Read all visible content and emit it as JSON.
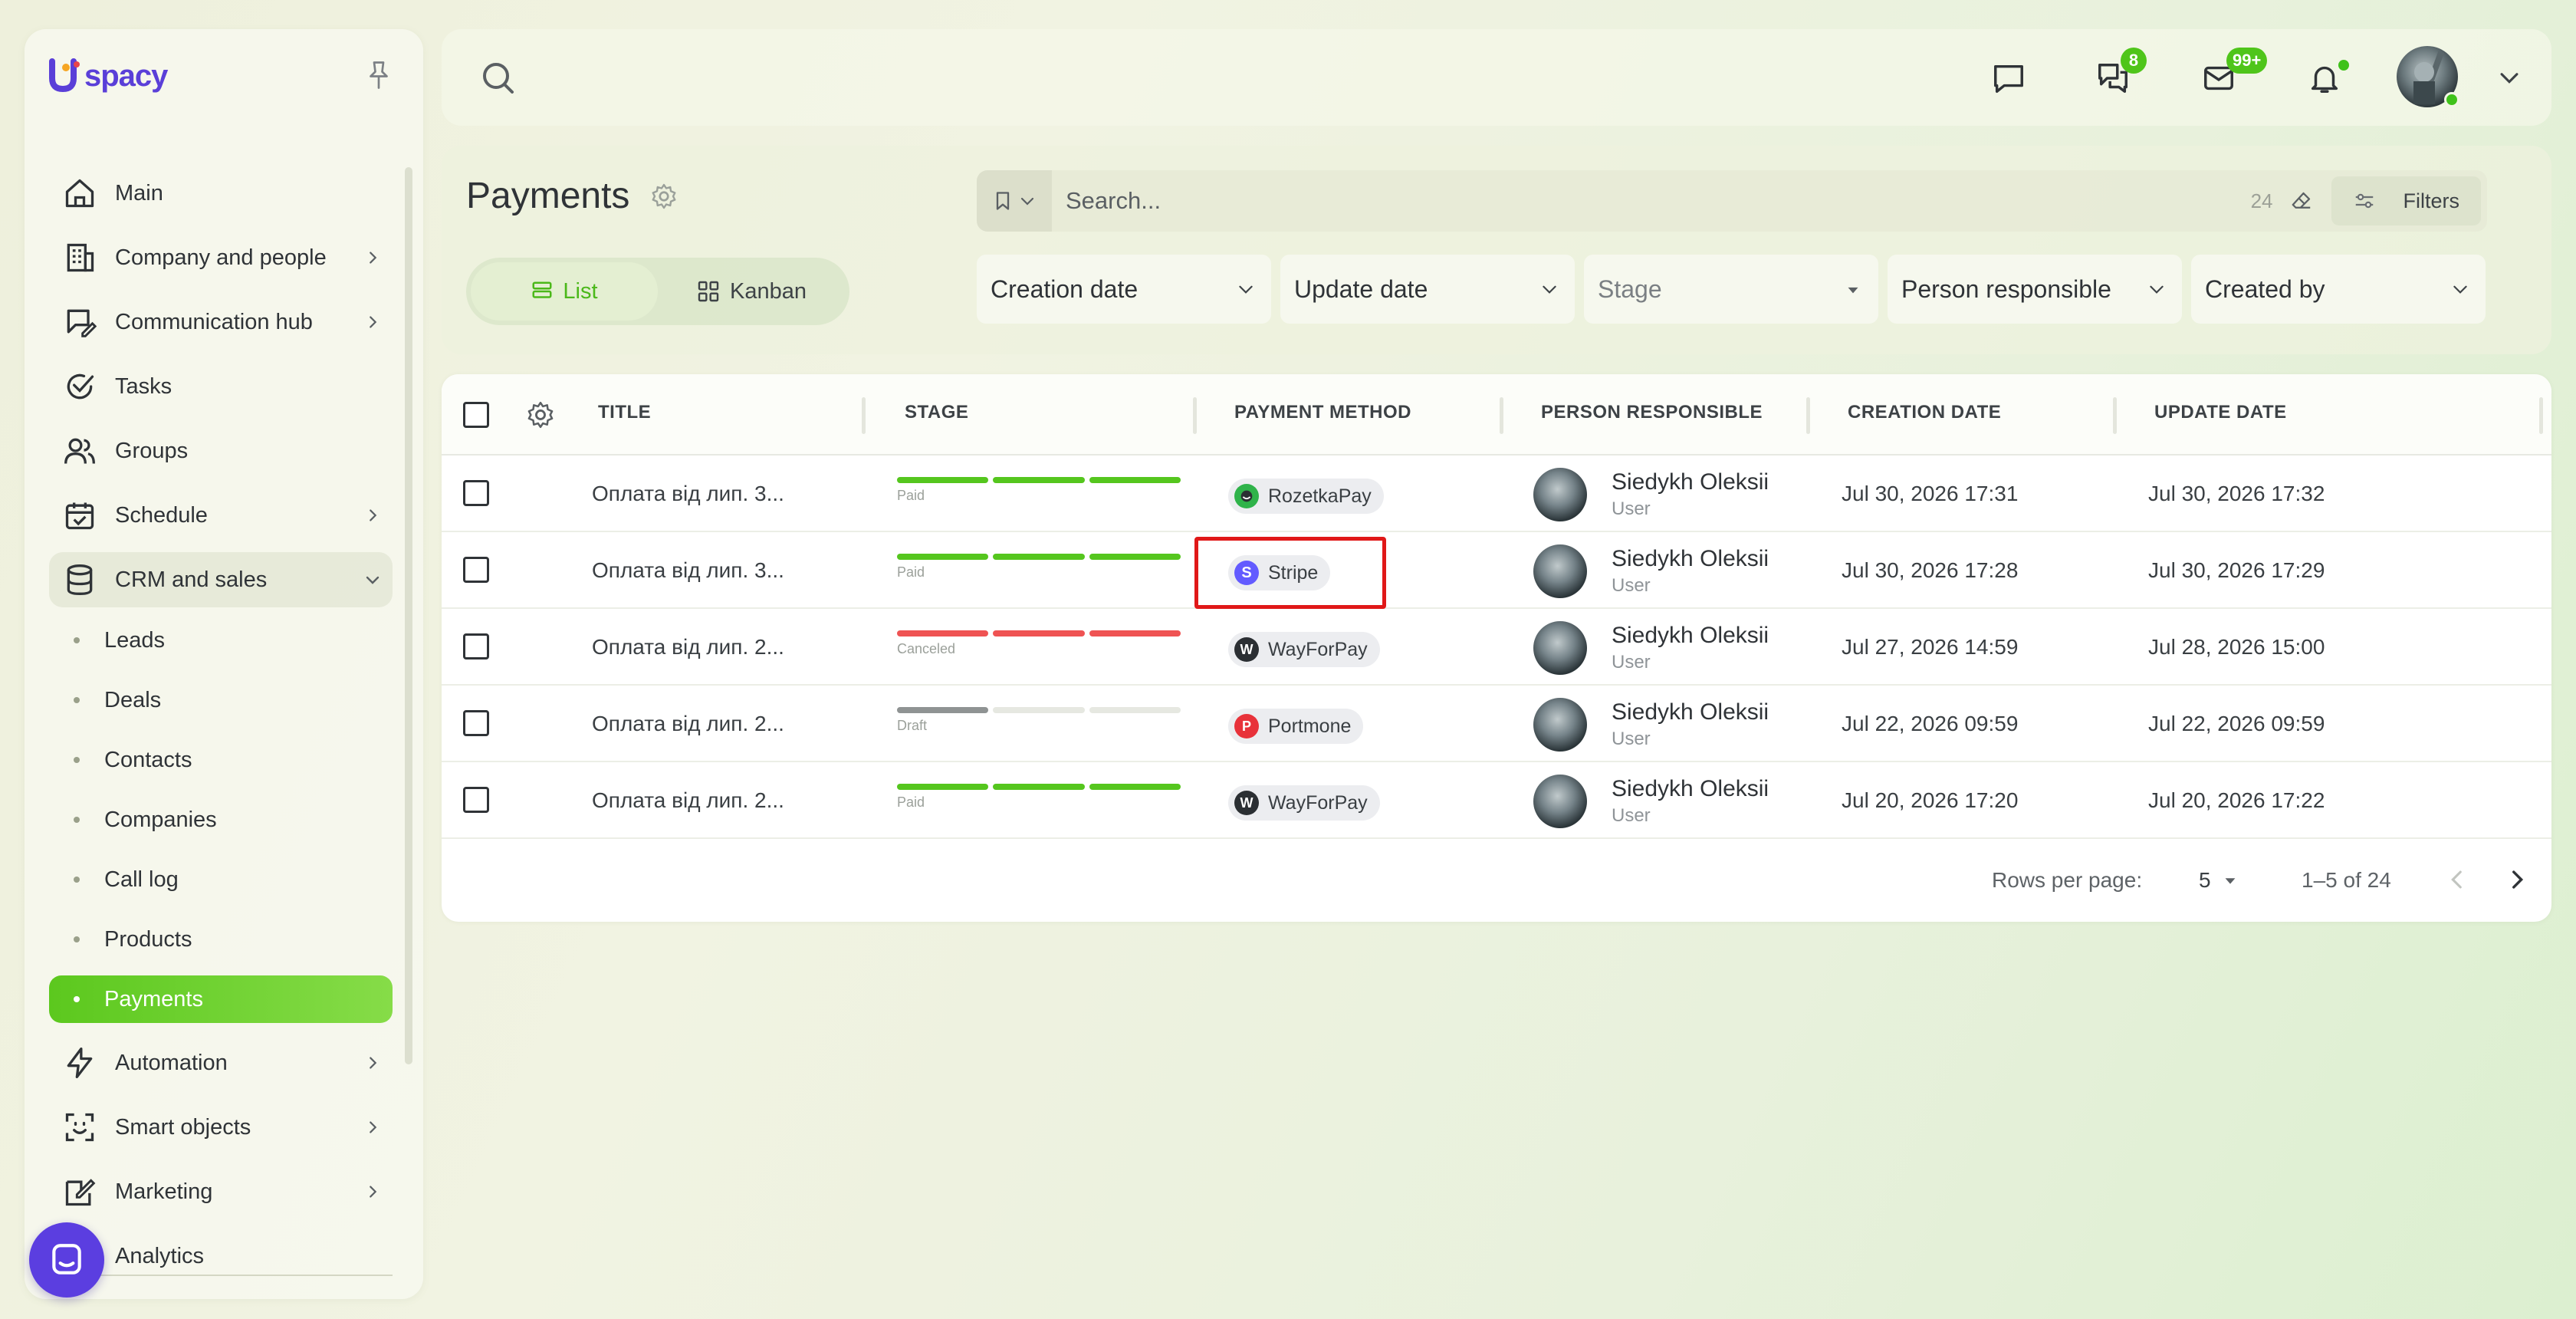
{
  "app": {
    "logo_text": "spacy",
    "brand_color": "#5a3fd8",
    "accent_color": "#5cc81e"
  },
  "sidebar": {
    "items": [
      {
        "label": "Main",
        "icon": "home-icon"
      },
      {
        "label": "Company and people",
        "icon": "building-icon",
        "has_children": true
      },
      {
        "label": "Communication hub",
        "icon": "chat-edit-icon",
        "has_children": true
      },
      {
        "label": "Tasks",
        "icon": "check-circle-icon"
      },
      {
        "label": "Groups",
        "icon": "users-icon"
      },
      {
        "label": "Schedule",
        "icon": "calendar-icon",
        "has_children": true
      },
      {
        "label": "CRM and sales",
        "icon": "database-icon",
        "has_children": true,
        "expanded": true
      }
    ],
    "crm_sub_items": [
      {
        "label": "Leads"
      },
      {
        "label": "Deals"
      },
      {
        "label": "Contacts"
      },
      {
        "label": "Companies"
      },
      {
        "label": "Call log"
      },
      {
        "label": "Products"
      },
      {
        "label": "Payments",
        "active": true
      }
    ],
    "bottom_items": [
      {
        "label": "Automation",
        "icon": "lightning-icon",
        "has_children": true
      },
      {
        "label": "Smart objects",
        "icon": "scan-icon",
        "has_children": true
      },
      {
        "label": "Marketing",
        "icon": "marketing-icon",
        "has_children": true
      },
      {
        "label": "Analytics",
        "icon": "analytics-icon"
      }
    ]
  },
  "topbar": {
    "chat_badge": "8",
    "mail_badge": "99+",
    "notification_dot": true
  },
  "header": {
    "title": "Payments",
    "view_list": "List",
    "view_kanban": "Kanban",
    "search_placeholder": "Search...",
    "search_count": "24",
    "filters_label": "Filters",
    "filters": [
      {
        "label": "Creation date"
      },
      {
        "label": "Update date"
      },
      {
        "label": "Stage",
        "placeholder": true
      },
      {
        "label": "Person responsible"
      },
      {
        "label": "Created by"
      }
    ]
  },
  "table": {
    "columns": [
      "TITLE",
      "STAGE",
      "PAYMENT METHOD",
      "PERSON RESPONSIBLE",
      "CREATION DATE",
      "UPDATE DATE"
    ],
    "rows": [
      {
        "title": "Оплата від лип. 3...",
        "stage": "Paid",
        "stage_progress": 3,
        "stage_color": "#55c61e",
        "method": "RozetkaPay",
        "method_icon": "rozetkapay-icon",
        "method_color": "#2fb34a",
        "person": "Siedykh Oleksii",
        "role": "User",
        "created": "Jul 30, 2026 17:31",
        "updated": "Jul 30, 2026 17:32"
      },
      {
        "title": "Оплата від лип. 3...",
        "stage": "Paid",
        "stage_progress": 3,
        "stage_color": "#55c61e",
        "method": "Stripe",
        "method_icon": "stripe-icon",
        "method_color": "#635bff",
        "person": "Siedykh Oleksii",
        "role": "User",
        "created": "Jul 30, 2026 17:28",
        "updated": "Jul 30, 2026 17:29"
      },
      {
        "title": "Оплата від лип. 2...",
        "stage": "Canceled",
        "stage_progress": 3,
        "stage_color": "#ef5353",
        "method": "WayForPay",
        "method_icon": "wayforpay-icon",
        "method_color": "#2b2f33",
        "person": "Siedykh Oleksii",
        "role": "User",
        "created": "Jul 27, 2026 14:59",
        "updated": "Jul 28, 2026 15:00"
      },
      {
        "title": "Оплата від лип. 2...",
        "stage": "Draft",
        "stage_progress": 1,
        "stage_color": "#8f9393",
        "method": "Portmone",
        "method_icon": "portmone-icon",
        "method_color": "#e8323a",
        "person": "Siedykh Oleksii",
        "role": "User",
        "created": "Jul 22, 2026 09:59",
        "updated": "Jul 22, 2026 09:59"
      },
      {
        "title": "Оплата від лип. 2...",
        "stage": "Paid",
        "stage_progress": 3,
        "stage_color": "#55c61e",
        "method": "WayForPay",
        "method_icon": "wayforpay-icon",
        "method_color": "#2b2f33",
        "person": "Siedykh Oleksii",
        "role": "User",
        "created": "Jul 20, 2026 17:20",
        "updated": "Jul 20, 2026 17:22"
      }
    ]
  },
  "pagination": {
    "rows_per_page_label": "Rows per page:",
    "rows_per_page_value": "5",
    "range": "1–5 of 24"
  }
}
